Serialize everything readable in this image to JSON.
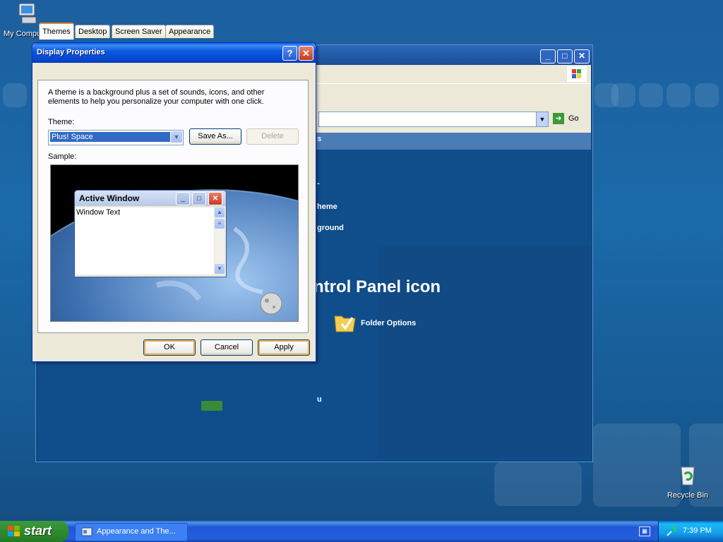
{
  "desktop": {
    "my_computer": "My Computer",
    "recycle_bin": "Recycle Bin"
  },
  "control_panel": {
    "go_label": "Go",
    "frag_tasks": "s",
    "frag_dash": "-",
    "frag_theme": "heme",
    "frag_background": "ground",
    "frag_heading": "ntrol Panel icon",
    "folder_options": "Folder Options",
    "frag_menu": "u"
  },
  "dialog": {
    "title": "Display Properties",
    "help_glyph": "?",
    "close_glyph": "✕",
    "tabs": [
      {
        "label": "Themes",
        "active": true
      },
      {
        "label": "Desktop",
        "active": false
      },
      {
        "label": "Screen Saver",
        "active": false
      },
      {
        "label": "Appearance",
        "active": false
      }
    ],
    "description": "A theme is a background plus a set of sounds, icons, and other elements to help you personalize your computer with one click.",
    "theme_label": "Theme:",
    "theme_value": "Plus! Space",
    "save_as": "Save As...",
    "delete": "Delete",
    "sample_label": "Sample:",
    "mini_window_title": "Active Window",
    "mini_window_text": "Window Text",
    "ok": "OK",
    "cancel": "Cancel",
    "apply": "Apply"
  },
  "taskbar": {
    "start": "start",
    "task_item": "Appearance and The...",
    "clock": "7:39 PM"
  },
  "colors": {
    "xp_blue_title": "#0a5ae0",
    "dialog_face": "#ece9d8",
    "selection": "#316ac5",
    "start_green": "#2f8a2f"
  }
}
